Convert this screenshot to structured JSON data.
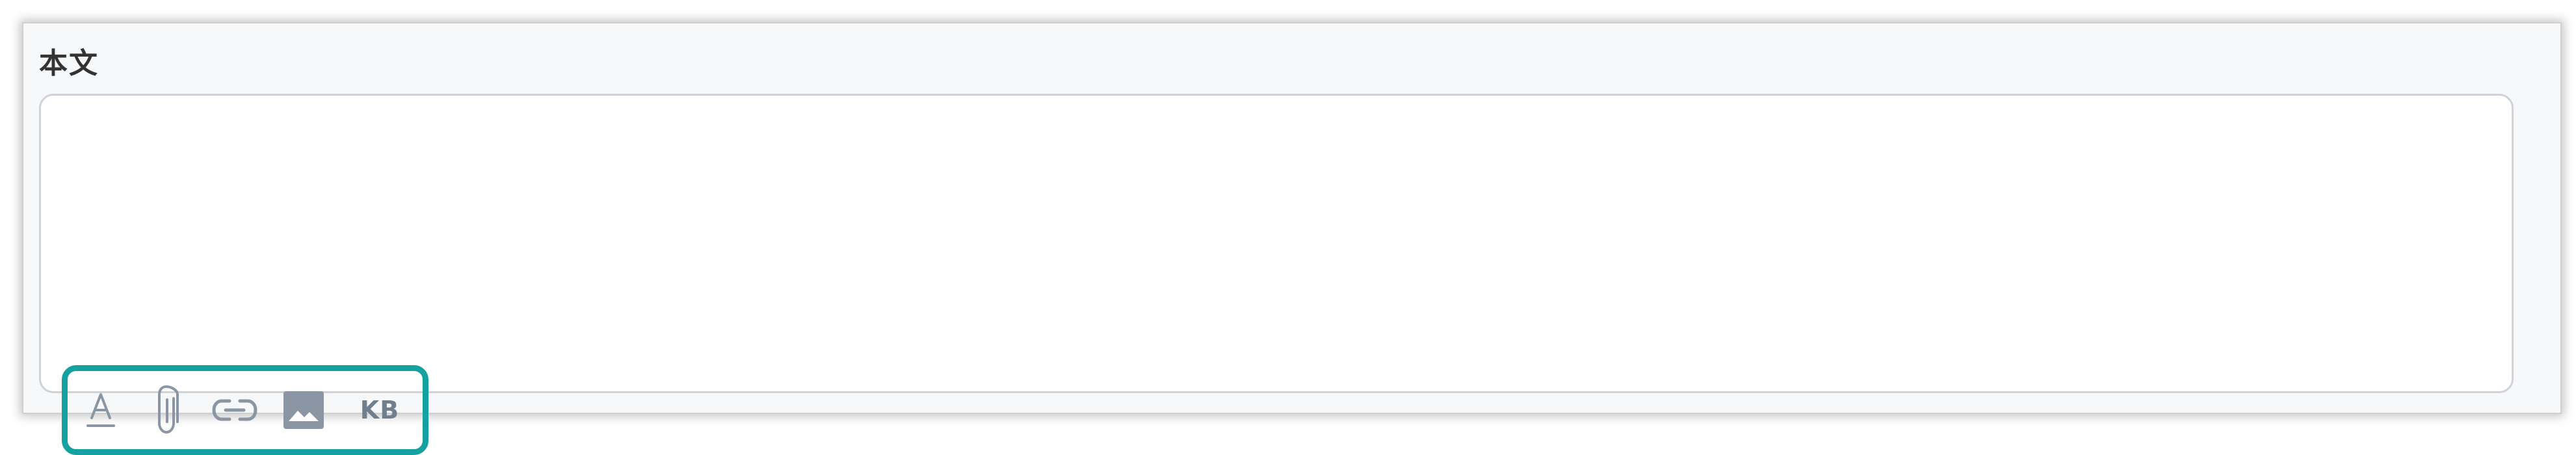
{
  "field": {
    "label": "本文",
    "value": ""
  },
  "toolbar": {
    "tools": [
      {
        "icon": "text-format-icon"
      },
      {
        "icon": "attachment-icon"
      },
      {
        "icon": "link-icon"
      },
      {
        "icon": "image-icon"
      },
      {
        "icon": "kb-icon",
        "label": "KB"
      }
    ],
    "highlight_color": "#16a1a1",
    "icon_color": "#8a96a3"
  }
}
